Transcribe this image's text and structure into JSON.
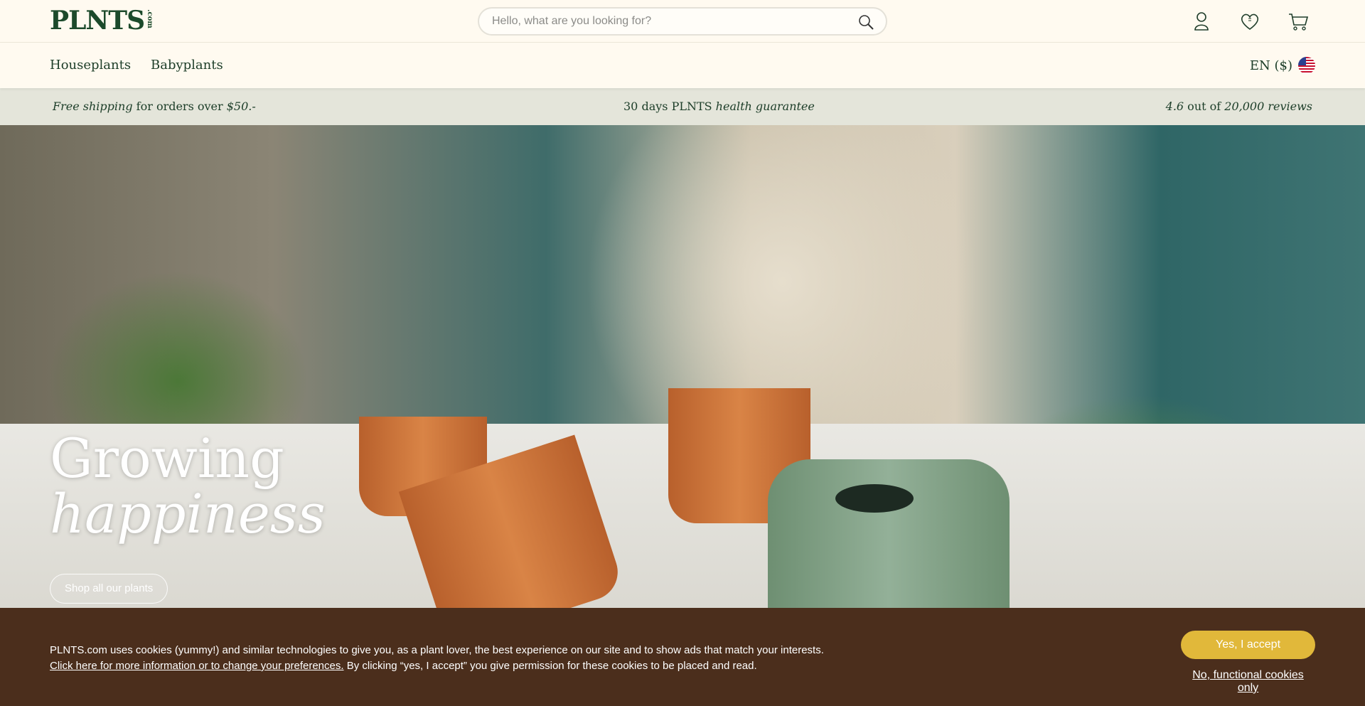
{
  "header": {
    "logo_text": "PLNTS",
    "logo_suffix": ".com",
    "search": {
      "placeholder": "Hello, what are you looking for?"
    },
    "icons": [
      "account-icon",
      "wishlist-heart-icon",
      "cart-icon"
    ]
  },
  "nav": {
    "items": [
      {
        "label": "Houseplants"
      },
      {
        "label": "Babyplants"
      }
    ],
    "language": "EN ($)"
  },
  "usp": {
    "shipping": {
      "emph": "Free shipping",
      "rest": " for orders over ",
      "amount": "$50.-"
    },
    "guarantee": {
      "prefix": "30 days PLNTS ",
      "emph": "health guarantee"
    },
    "reviews": {
      "score": "4.6",
      "mid": " out of ",
      "emph": "20,000 reviews"
    }
  },
  "hero": {
    "title_line1": "Growing",
    "title_line2": "happiness",
    "cta": "Shop all our plants"
  },
  "cookie": {
    "text": "PLNTS.com uses cookies (yummy!) and similar technologies to give you, as a plant lover, the best experience on our site and to show ads that match your interests.",
    "link": "Click here for more information or to change your preferences.",
    "text2": " By clicking “yes, I accept” you give permission for these cookies to be placed and read.",
    "accept": "Yes, I accept",
    "functional": "No, functional cookies only"
  },
  "colors": {
    "brand_green": "#1c4a2b",
    "background": "#fffaf0",
    "usp_bar": "#e4e5da",
    "cookie_bg": "#4b2e1c",
    "accept_yellow": "#e1b83a"
  }
}
